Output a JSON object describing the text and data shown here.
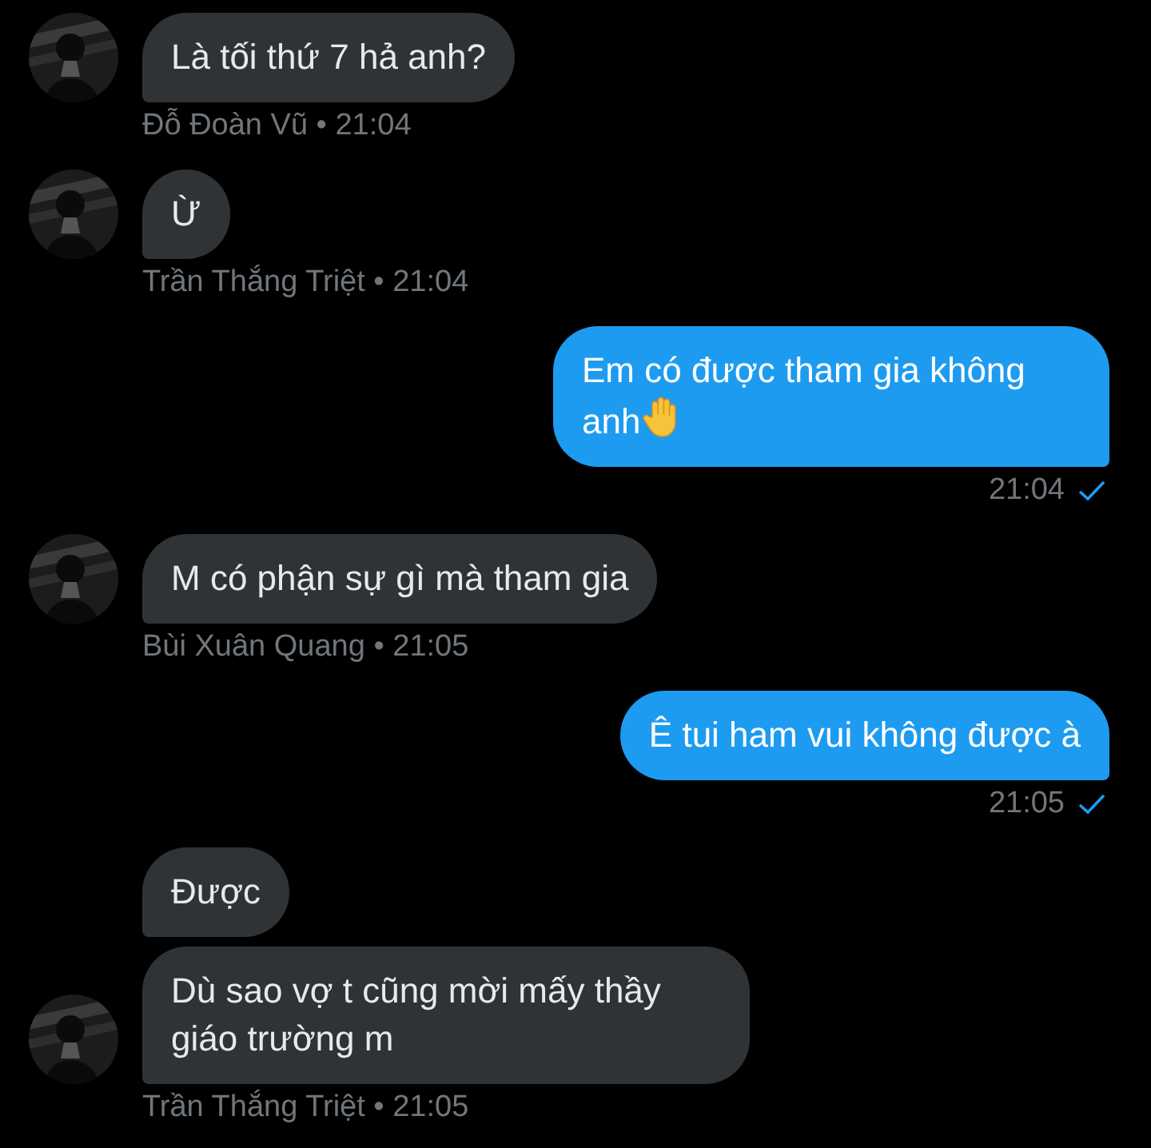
{
  "messages": [
    {
      "kind": "incoming",
      "avatar": {
        "kind": "picture"
      },
      "bubbles": [
        {
          "text": "Là tối thứ 7 hả anh?"
        }
      ],
      "meta": "Đỗ Đoàn Vũ • 21:04"
    },
    {
      "kind": "incoming",
      "avatar": {
        "kind": "picture"
      },
      "bubbles": [
        {
          "text": "Ừ"
        }
      ],
      "meta": "Trần Thắng Triệt • 21:04"
    },
    {
      "kind": "outgoing",
      "bubbles": [
        {
          "text": "Em có được tham gia không anh",
          "hand_emoji": true
        }
      ],
      "meta": "21:04",
      "delivered": true
    },
    {
      "kind": "incoming",
      "avatar": {
        "kind": "picture"
      },
      "bubbles": [
        {
          "text": "M có phận sự gì mà tham gia"
        }
      ],
      "meta": "Bùi Xuân Quang • 21:05"
    },
    {
      "kind": "outgoing",
      "bubbles": [
        {
          "text": "Ê tui ham vui không được à"
        }
      ],
      "meta": "21:05",
      "delivered": true
    },
    {
      "kind": "incoming",
      "avatar": {
        "kind": "picture"
      },
      "bubbles": [
        {
          "text": "Được"
        },
        {
          "text": "Dù sao vợ t cũng mời mấy thầy giáo trường m"
        }
      ],
      "meta": "Trần Thắng Triệt • 21:05"
    }
  ]
}
